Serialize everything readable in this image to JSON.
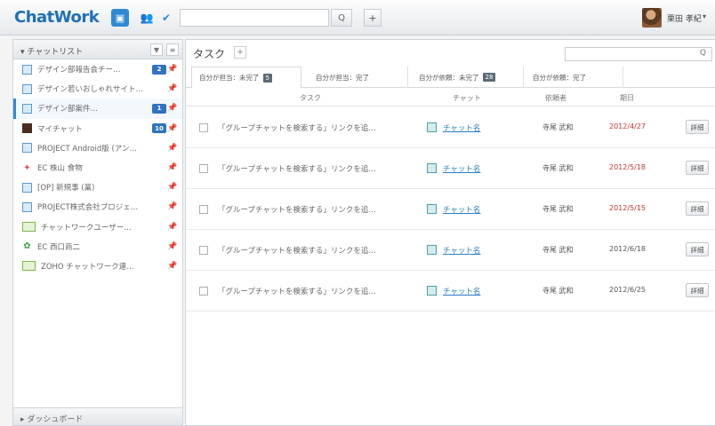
{
  "header": {
    "logo": "ChatWork",
    "search_placeholder": "",
    "search_button": "Q",
    "add_button": "+",
    "username": "栗田 孝紀",
    "user_caret": "▾"
  },
  "sidebar": {
    "title": "▾ チャットリスト",
    "filter_button": "▼",
    "sort_button": "≡",
    "rooms": [
      {
        "label": "デザイン部報告会チー…",
        "badge": "2",
        "pin": "📌"
      },
      {
        "label": "デザイン若いおしゃれサイト…",
        "badge": "",
        "pin": "📌"
      },
      {
        "label": "デザイン部案件…",
        "badge": "1",
        "pin": "📌"
      },
      {
        "label": "マイチャット",
        "badge": "10",
        "pin": "📌"
      },
      {
        "label": "PROJECT Android版 (アン…",
        "badge": "",
        "pin": "📌"
      },
      {
        "label": "EC 株山 食物",
        "badge": "",
        "pin": "📌"
      },
      {
        "label": "[OP] 新規事 (業)",
        "badge": "",
        "pin": "📌"
      },
      {
        "label": "PROJECT株式会社プロジェ…",
        "badge": "",
        "pin": "📌"
      },
      {
        "label": "チャットワークユーザー…",
        "badge": "",
        "pin": "📌"
      },
      {
        "label": "EC 西口商二",
        "badge": "",
        "pin": "📌"
      },
      {
        "label": "ZOHO チャットワーク連…",
        "badge": "",
        "pin": "📌"
      }
    ],
    "footer": "▸ ダッシュボード"
  },
  "main": {
    "title": "タスク",
    "add_button": "+",
    "search_icon": "Q",
    "tabs": [
      {
        "label": "自分が担当：未完了",
        "count": "5"
      },
      {
        "label": "自分が担当：完了",
        "count": ""
      },
      {
        "label": "自分が依頼：未完了",
        "count": "28"
      },
      {
        "label": "自分が依頼：完了",
        "count": ""
      }
    ],
    "columns": {
      "task": "タスク",
      "chat": "チャット",
      "assigner": "依頼者",
      "due": "期日"
    },
    "tasks": [
      {
        "text": "「グループチャットを検索する」リンクを追…",
        "chat": "チャット名",
        "assigner": "寺尾 武和",
        "due": "2012/4/27",
        "due_color": "#c8352f",
        "button": "詳細"
      },
      {
        "text": "「グループチャットを検索する」リンクを追…",
        "chat": "チャット名",
        "assigner": "寺尾 武和",
        "due": "2012/5/18",
        "due_color": "#c8352f",
        "button": "詳細"
      },
      {
        "text": "「グループチャットを検索する」リンクを追…",
        "chat": "チャット名",
        "assigner": "寺尾 武和",
        "due": "2012/5/15",
        "due_color": "#c8352f",
        "button": "詳細"
      },
      {
        "text": "「グループチャットを検索する」リンクを追…",
        "chat": "チャット名",
        "assigner": "寺尾 武和",
        "due": "2012/6/18",
        "due_color": "#555555",
        "button": "詳細"
      },
      {
        "text": "「グループチャットを検索する」リンクを追…",
        "chat": "チャット名",
        "assigner": "寺尾 武和",
        "due": "2012/6/25",
        "due_color": "#555555",
        "button": "詳細"
      }
    ]
  }
}
